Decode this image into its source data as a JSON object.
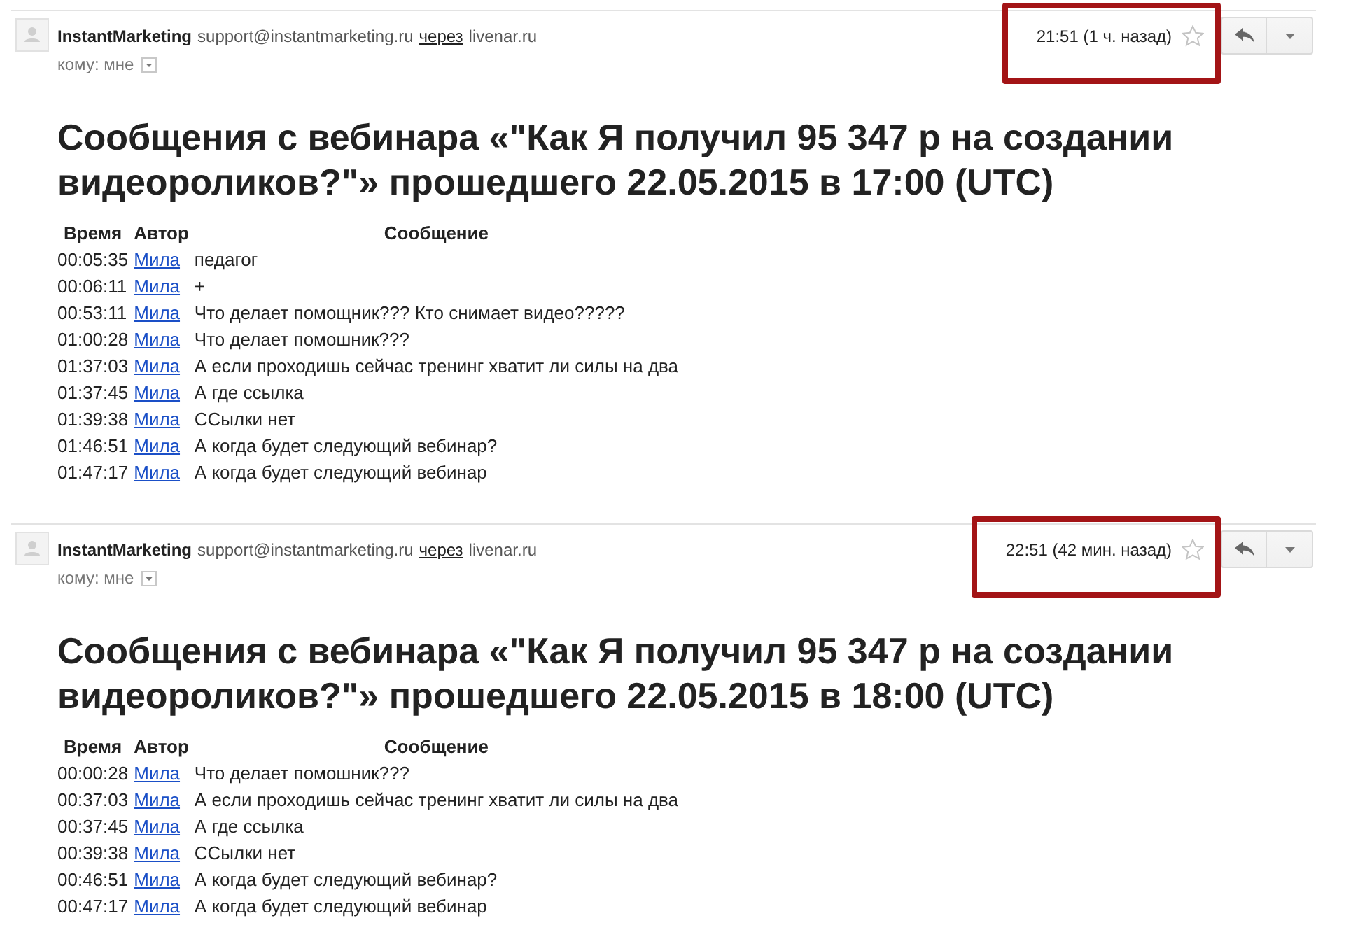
{
  "messages": [
    {
      "sender": {
        "name": "InstantMarketing",
        "email": "support@instantmarketing.ru",
        "via_label": "через",
        "via_domain": "livenar.ru"
      },
      "recipient": "кому: мне",
      "time": "21:51 (1 ч. назад)",
      "starred": false,
      "highlighted": true,
      "title": "Сообщения с вебинара «\"Как Я получил 95 347 р на создании видеороликов?\"» прошедшего 22.05.2015 в 17:00 (UTC)",
      "table": {
        "columns": [
          "Время",
          "Автор",
          "Сообщение"
        ],
        "rows": [
          {
            "time": "00:05:35",
            "author": "Мила",
            "message": "педагог"
          },
          {
            "time": "00:06:11",
            "author": "Мила",
            "message": "+"
          },
          {
            "time": "00:53:11",
            "author": "Мила",
            "message": "Что делает помощник??? Кто снимает видео?????"
          },
          {
            "time": "01:00:28",
            "author": "Мила",
            "message": "Что делает помошник???"
          },
          {
            "time": "01:37:03",
            "author": "Мила",
            "message": "А если проходишь сейчас тренинг хватит ли силы на два"
          },
          {
            "time": "01:37:45",
            "author": "Мила",
            "message": "А где ссылка"
          },
          {
            "time": "01:39:38",
            "author": "Мила",
            "message": "ССылки нет"
          },
          {
            "time": "01:46:51",
            "author": "Мила",
            "message": "А когда будет следующий вебинар?"
          },
          {
            "time": "01:47:17",
            "author": "Мила",
            "message": "А когда будет следующий вебинар"
          }
        ]
      }
    },
    {
      "sender": {
        "name": "InstantMarketing",
        "email": "support@instantmarketing.ru",
        "via_label": "через",
        "via_domain": "livenar.ru"
      },
      "recipient": "кому: мне",
      "time": "22:51 (42 мин. назад)",
      "starred": false,
      "highlighted": true,
      "title": "Сообщения с вебинара «\"Как Я получил 95 347 р на создании видеороликов?\"» прошедшего 22.05.2015 в 18:00 (UTC)",
      "table": {
        "columns": [
          "Время",
          "Автор",
          "Сообщение"
        ],
        "rows": [
          {
            "time": "00:00:28",
            "author": "Мила",
            "message": "Что делает помошник???"
          },
          {
            "time": "00:37:03",
            "author": "Мила",
            "message": "А если проходишь сейчас тренинг хватит ли силы на два"
          },
          {
            "time": "00:37:45",
            "author": "Мила",
            "message": "А где ссылка"
          },
          {
            "time": "00:39:38",
            "author": "Мила",
            "message": "ССылки нет"
          },
          {
            "time": "00:46:51",
            "author": "Мила",
            "message": "А когда будет следующий вебинар?"
          },
          {
            "time": "00:47:17",
            "author": "Мила",
            "message": "А когда будет следующий вебинар"
          }
        ]
      }
    }
  ]
}
